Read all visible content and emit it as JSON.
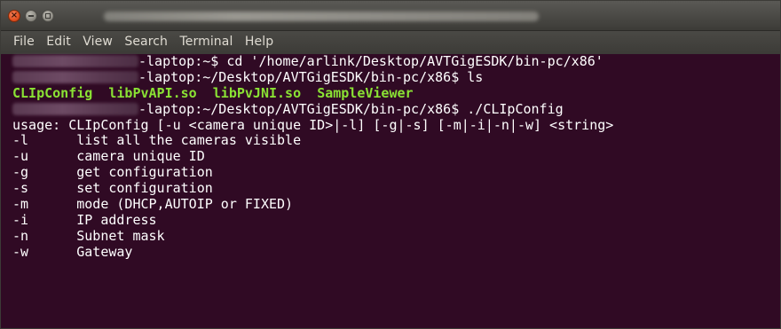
{
  "window": {
    "controls": {
      "close_icon": "close-icon",
      "minimize_icon": "minimize-icon",
      "maximize_icon": "maximize-icon"
    }
  },
  "menu": [
    "File",
    "Edit",
    "View",
    "Search",
    "Terminal",
    "Help"
  ],
  "prompt": {
    "cmd1": "-laptop:~$ cd '/home/arlink/Desktop/AVTGigESDK/bin-pc/x86'",
    "cmd2": "-laptop:~/Desktop/AVTGigESDK/bin-pc/x86$ ls",
    "cmd3": "-laptop:~/Desktop/AVTGigESDK/bin-pc/x86$ ./CLIpConfig"
  },
  "ls_output": [
    "CLIpConfig",
    "libPvAPI.so",
    "libPvJNI.so",
    "SampleViewer"
  ],
  "usage": "usage: CLIpConfig [-u <camera unique ID>|-l] [-g|-s] [-m|-i|-n|-w] <string>",
  "options": [
    {
      "flag": "-l",
      "desc": "list all the cameras visible"
    },
    {
      "flag": "-u",
      "desc": "camera unique ID"
    },
    {
      "flag": "-g",
      "desc": "get configuration"
    },
    {
      "flag": "-s",
      "desc": "set configuration"
    },
    {
      "flag": "-m",
      "desc": "mode (DHCP,AUTOIP or FIXED)"
    },
    {
      "flag": "-i",
      "desc": "IP address"
    },
    {
      "flag": "-n",
      "desc": "Subnet mask"
    },
    {
      "flag": "-w",
      "desc": "Gateway"
    }
  ],
  "colors": {
    "terminal_bg": "#300a24",
    "executable_green": "#8ae234",
    "text": "#ffffff"
  }
}
